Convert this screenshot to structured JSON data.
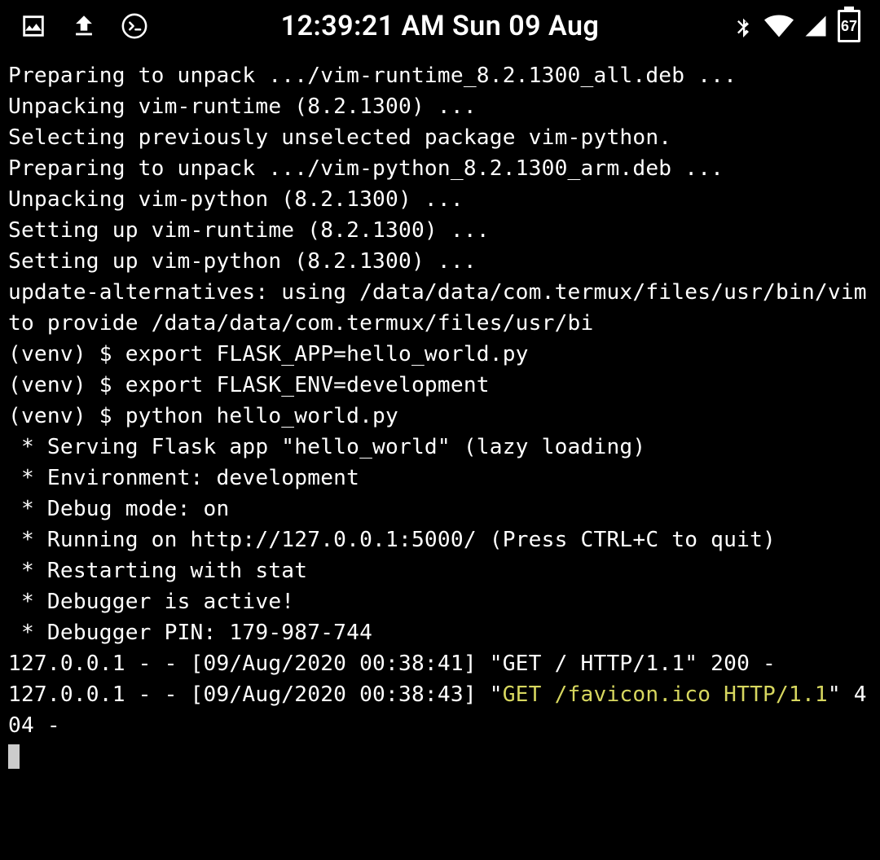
{
  "statusbar": {
    "clock": "12:39:21 AM Sun 09 Aug",
    "battery_pct": "67"
  },
  "terminal": {
    "lines": [
      "Preparing to unpack .../vim-runtime_8.2.1300_all.deb ...",
      "Unpacking vim-runtime (8.2.1300) ...",
      "Selecting previously unselected package vim-python.",
      "Preparing to unpack .../vim-python_8.2.1300_arm.deb ...",
      "Unpacking vim-python (8.2.1300) ...",
      "Setting up vim-runtime (8.2.1300) ...",
      "Setting up vim-python (8.2.1300) ...",
      "update-alternatives: using /data/data/com.termux/files/usr/bin/vim to provide /data/data/com.termux/files/usr/bi",
      "(venv) $ export FLASK_APP=hello_world.py",
      "(venv) $ export FLASK_ENV=development",
      "(venv) $ python hello_world.py",
      " * Serving Flask app \"hello_world\" (lazy loading)",
      " * Environment: development",
      " * Debug mode: on",
      " * Running on http://127.0.0.1:5000/ (Press CTRL+C to quit)",
      " * Restarting with stat",
      " * Debugger is active!",
      " * Debugger PIN: 179-987-744",
      "127.0.0.1 - - [09/Aug/2020 00:38:41] \"GET / HTTP/1.1\" 200 -"
    ],
    "log2_prefix": "127.0.0.1 - - [09/Aug/2020 00:38:43] \"",
    "log2_hl": "GET /favicon.ico HTTP/1.1",
    "log2_suffix": "\" 404 -"
  }
}
